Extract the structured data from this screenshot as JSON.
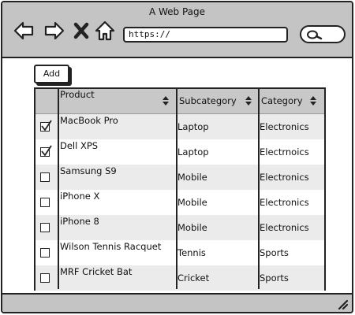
{
  "window": {
    "title": "A Web Page"
  },
  "address_bar": {
    "value": "https://"
  },
  "toolbar": {
    "add_label": "Add"
  },
  "table": {
    "columns": [
      {
        "label": "Product",
        "sortable": true
      },
      {
        "label": "Subcategory",
        "sortable": true
      },
      {
        "label": "Category",
        "sortable": true
      }
    ],
    "rows": [
      {
        "checked": true,
        "product": "MacBook Pro",
        "subcategory": "Laptop",
        "category": "Electronics"
      },
      {
        "checked": true,
        "product": "Dell XPS",
        "subcategory": "Laptop",
        "category": "Electrnoics"
      },
      {
        "checked": false,
        "product": "Samsung S9",
        "subcategory": "Mobile",
        "category": "Electronics"
      },
      {
        "checked": false,
        "product": "iPhone X",
        "subcategory": "Mobile",
        "category": "Electronics"
      },
      {
        "checked": false,
        "product": "iPhone 8",
        "subcategory": "Mobile",
        "category": "Electronics"
      },
      {
        "checked": false,
        "product": "Wilson Tennis Racquet",
        "subcategory": "Tennis",
        "category": "Sports"
      },
      {
        "checked": false,
        "product": "MRF Cricket Bat",
        "subcategory": "Cricket",
        "category": "Sports"
      }
    ]
  },
  "icons": {
    "back": "back-arrow-icon",
    "forward": "forward-arrow-icon",
    "stop": "close-icon",
    "home": "home-icon",
    "search": "search-icon",
    "sort": "sort-arrows-icon",
    "resize": "resize-grip-icon"
  },
  "colors": {
    "chrome": "#c4c4c4",
    "header_row": "#c8c8c8",
    "shaded_row": "#ebebeb",
    "border": "#222222"
  }
}
